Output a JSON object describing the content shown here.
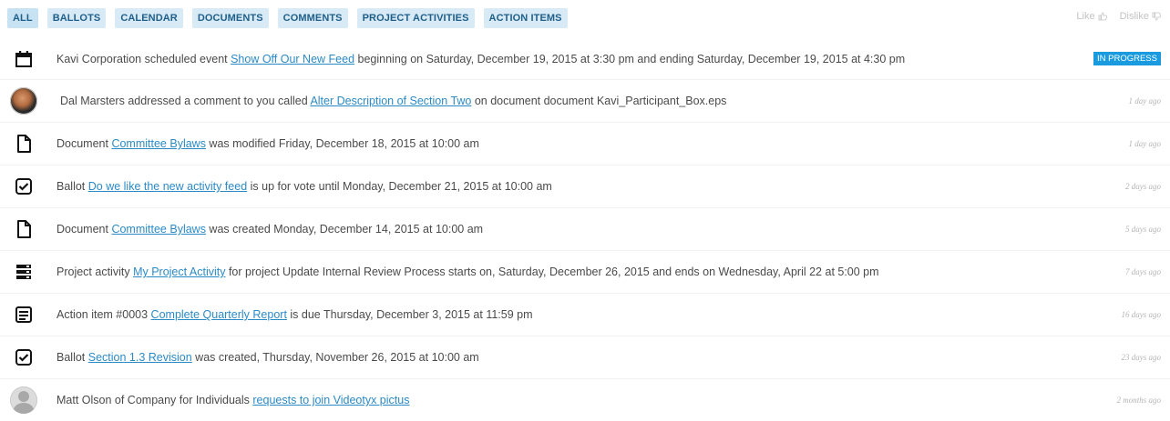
{
  "filters": [
    "ALL",
    "BALLOTS",
    "CALENDAR",
    "DOCUMENTS",
    "COMMENTS",
    "PROJECT ACTIVITIES",
    "ACTION ITEMS"
  ],
  "actions": {
    "like": "Like",
    "dislike": "Dislike"
  },
  "feed": [
    {
      "icon": "calendar-icon",
      "pre": "Kavi Corporation scheduled event ",
      "link": "Show Off Our New Feed",
      "post": " beginning on Saturday, December 19, 2015 at 3:30 pm and ending Saturday, December 19, 2015 at 4:30 pm",
      "badge": "IN PROGRESS",
      "time": ""
    },
    {
      "icon": "user-avatar",
      "pre": "Dal Marsters addressed a comment to you called ",
      "link": "Alter Description of Section Two",
      "post": " on document document Kavi_Participant_Box.eps",
      "time": "1 day ago"
    },
    {
      "icon": "document-icon",
      "pre": "Document ",
      "link": "Committee Bylaws",
      "post": " was modified Friday, December 18, 2015 at 10:00 am",
      "time": "1 day ago"
    },
    {
      "icon": "ballot-check-icon",
      "pre": "Ballot ",
      "link": "Do we like the new activity feed",
      "post": " is up for vote until Monday, December 21, 2015 at 10:00 am",
      "time": "2 days ago"
    },
    {
      "icon": "document-icon",
      "pre": "Document ",
      "link": "Committee Bylaws",
      "post": " was created Monday, December 14, 2015 at 10:00 am",
      "time": "5 days ago"
    },
    {
      "icon": "project-activity-icon",
      "pre": "Project activity ",
      "link": "My Project Activity",
      "post": " for project Update Internal Review Process starts on, Saturday, December 26, 2015 and ends on Wednesday, April 22 at 5:00 pm",
      "time": "7 days ago"
    },
    {
      "icon": "action-item-icon",
      "pre": "Action item #0003 ",
      "link": "Complete Quarterly Report",
      "post": " is due Thursday, December 3, 2015 at 11:59 pm",
      "time": "16 days ago"
    },
    {
      "icon": "ballot-check-icon",
      "pre": "Ballot ",
      "link": "Section 1.3 Revision",
      "post": " was created, Thursday, November 26, 2015 at 10:00 am",
      "time": "23 days ago"
    },
    {
      "icon": "default-avatar",
      "pre": "Matt Olson of Company for Individuals ",
      "link": "requests to join Videotyx pictus",
      "post": "",
      "time": "2 months ago"
    }
  ]
}
